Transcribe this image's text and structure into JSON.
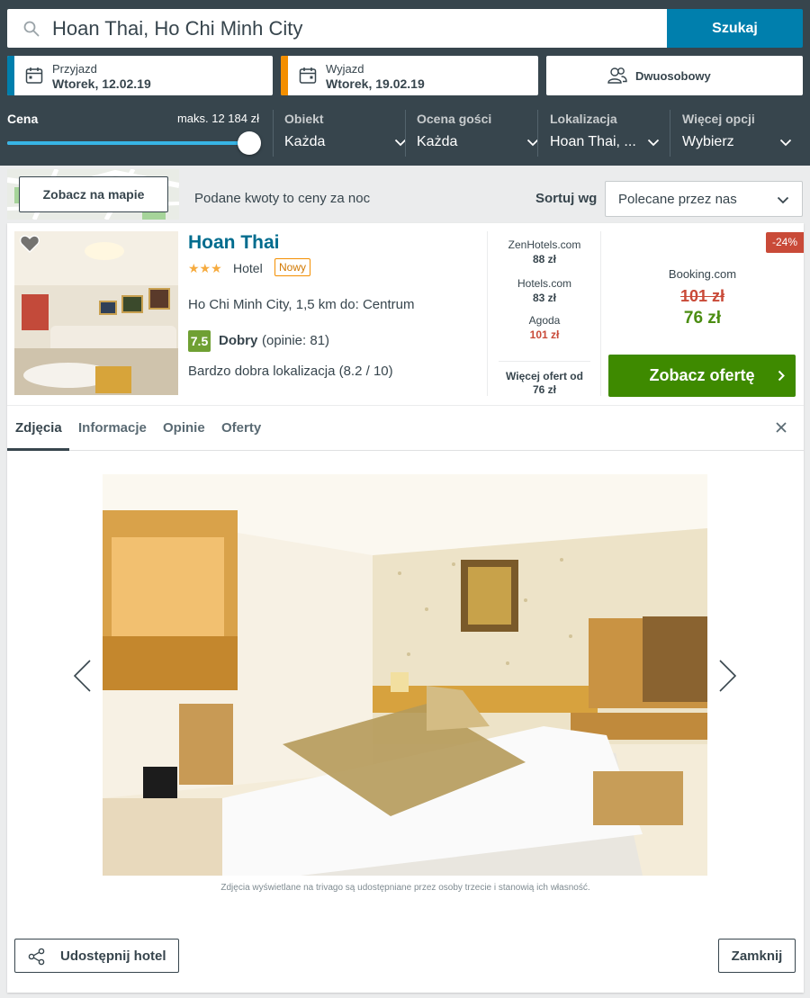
{
  "search": {
    "value": "Hoan Thai, Ho Chi Minh City",
    "button_label": "Szukaj"
  },
  "dates": {
    "checkin_label": "Przyjazd",
    "checkin_value": "Wtorek, 12.02.19",
    "checkout_label": "Wyjazd",
    "checkout_value": "Wtorek, 19.02.19"
  },
  "room": {
    "value": "Dwuosobowy"
  },
  "filters": {
    "price_label": "Cena",
    "price_max": "maks. 12 184 zł",
    "price_slider_fraction": 1.0,
    "property_label": "Obiekt",
    "property_value": "Każda",
    "rating_label": "Ocena gości",
    "rating_value": "Każda",
    "location_label": "Lokalizacja",
    "location_value": "Hoan Thai, ...",
    "more_label": "Więcej opcji",
    "more_value": "Wybierz"
  },
  "toolbar": {
    "map_button": "Zobacz na mapie",
    "price_note": "Podane kwoty to ceny za noc",
    "sort_label": "Sortuj wg",
    "sort_value": "Polecane przez nas"
  },
  "hotel": {
    "name": "Hoan Thai",
    "stars": "★★★",
    "star_count": 3,
    "type": "Hotel",
    "new_badge": "Nowy",
    "location": "Ho Chi Minh City, 1,5 km do: Centrum",
    "rating_score": "7.5",
    "rating_text": "Dobry",
    "rating_count": "(opinie: 81)",
    "location_rating": "Bardzo dobra lokalizacja (8.2 / 10)"
  },
  "offers": [
    {
      "site": "ZenHotels.com",
      "price": "88 zł"
    },
    {
      "site": "Hotels.com",
      "price": "83 zł"
    },
    {
      "site": "Agoda",
      "price": "101 zł"
    }
  ],
  "more_offers": {
    "line1": "Więcej ofert od",
    "line2": "76 zł"
  },
  "best_deal": {
    "discount": "-24%",
    "site": "Booking.com",
    "old_price": "101 zł",
    "price": "76 zł",
    "button": "Zobacz ofertę"
  },
  "tabs": [
    "Zdjęcia",
    "Informacje",
    "Opinie",
    "Oferty"
  ],
  "gallery": {
    "note": "Zdjęcia wyświetlane na trivago są udostępniane przez osoby trzecie i stanowią ich własność."
  },
  "footer": {
    "share_button": "Udostępnij hotel",
    "close_button": "Zamknij"
  },
  "colors": {
    "header_bg": "#37454d",
    "accent_blue": "#007fad",
    "accent_orange": "#f48f00",
    "deal_green": "#3e8a00",
    "discount_red": "#c94a38"
  }
}
